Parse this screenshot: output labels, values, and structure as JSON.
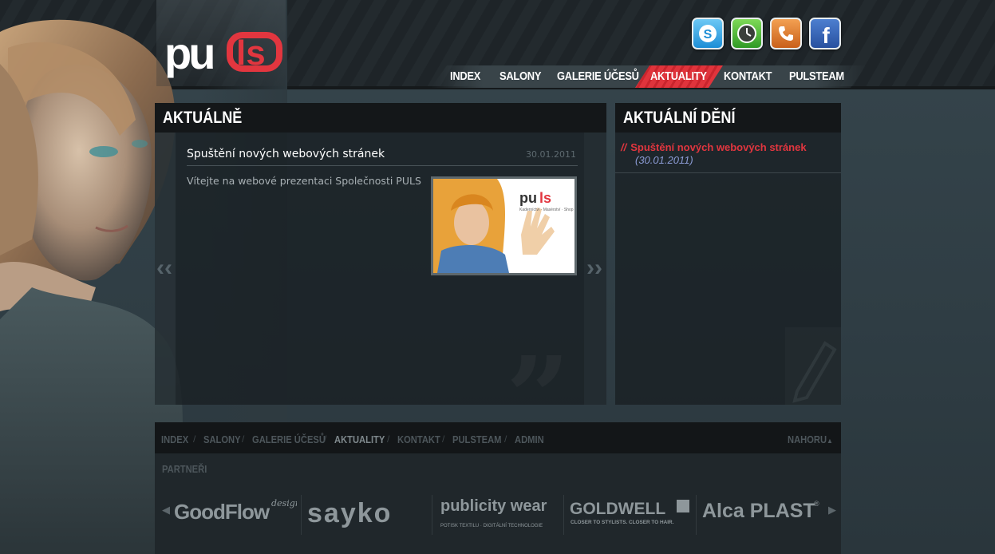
{
  "header": {
    "logo_text": "puls",
    "social": [
      "skype-icon",
      "clock-icon",
      "phone-icon",
      "facebook-icon"
    ],
    "nav": [
      "INDEX",
      "SALONY",
      "GALERIE ÚČESŮ",
      "AKTUALITY",
      "KONTAKT",
      "PULSTEAM"
    ],
    "nav_active": "AKTUALITY"
  },
  "main": {
    "title": "AKTUÁLNĚ",
    "news": {
      "title": "Spuštění nových webových stránek",
      "date": "30.01.2011",
      "text": "Vítejte na webové prezentaci Společnosti PULS"
    },
    "prev_arrow": "‹‹",
    "next_arrow": "››"
  },
  "sidebar": {
    "title": "AKTUÁLNÍ DĚNÍ",
    "slash": "//",
    "items": [
      {
        "label": "Spuštění nových webových stránek",
        "date": "(30.01.2011)"
      }
    ]
  },
  "footer": {
    "links": [
      "INDEX",
      "SALONY",
      "GALERIE ÚČESŮ",
      "AKTUALITY",
      "KONTAKT",
      "PULSTEAM",
      "ADMIN"
    ],
    "separator": "/",
    "top_link": "NAHORU",
    "partners_label": "PARTNEŘI",
    "partners": [
      {
        "name": "GoodFlow",
        "sub": "design"
      },
      {
        "name": "sayko"
      },
      {
        "name": "publicity wear",
        "sub": "POTISK TEXTILU · DIGITÁLNÍ TECHNOLOGIE"
      },
      {
        "name": "GOLDWELL",
        "sub": "CLOSER TO STYLISTS. CLOSER TO HAIR."
      },
      {
        "name": "Alca PLAST"
      }
    ]
  },
  "colors": {
    "accent": "#e2363f",
    "date_link": "#8c9cd6",
    "panel_head": "#141719"
  }
}
